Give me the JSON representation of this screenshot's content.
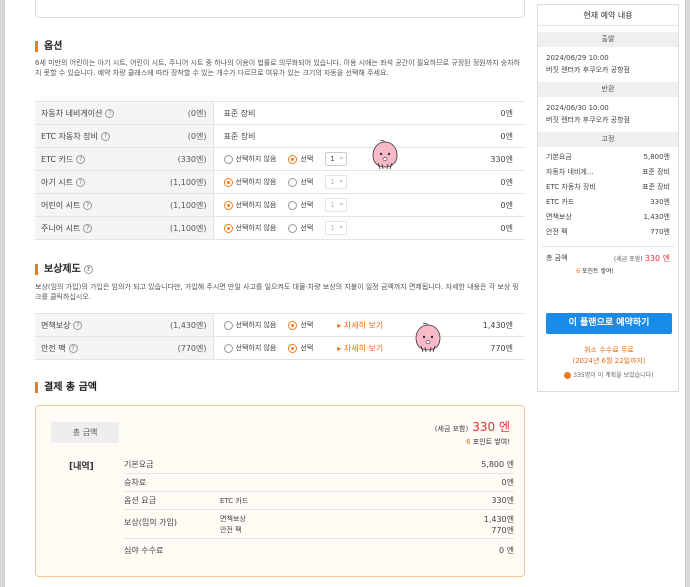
{
  "options": {
    "title": "옵션",
    "desc": "6세 미만의 어린이는 아기 시트, 어린이 시트, 주니어 시트 중 하나의 이용이 법률로 의무화되어 있습니다. 이용 시에는 좌석 공간이 필요하므로 규정된 정원까지 승차하지 못할 수 있습니다. 예약 차량 클래스에 따라 장착할 수 있는 개수가 다르므로 여유가 있는 크기의 자동을 선택해 주세요.",
    "rows": [
      {
        "name": "자동차 네비게이션",
        "price": "(0엔)",
        "text": "표준 장비",
        "value": "0엔"
      },
      {
        "name": "ETC 자동차 장비",
        "price": "(0엔)",
        "text": "표준 장비",
        "value": "0엔"
      },
      {
        "name": "ETC 카드",
        "price": "(330엔)",
        "opt_no": "선택하지 않음",
        "opt_yes": "선택",
        "qty": "1",
        "value": "330엔",
        "selected": "yes"
      },
      {
        "name": "아기 시트",
        "price": "(1,100엔)",
        "opt_no": "선택하지 않음",
        "opt_yes": "선택",
        "qty": "1",
        "value": "0엔",
        "selected": "no"
      },
      {
        "name": "어린이 시트",
        "price": "(1,100엔)",
        "opt_no": "선택하지 않음",
        "opt_yes": "선택",
        "qty": "1",
        "value": "0엔",
        "selected": "no"
      },
      {
        "name": "주니어 시트",
        "price": "(1,100엔)",
        "opt_no": "선택하지 않음",
        "opt_yes": "선택",
        "qty": "1",
        "value": "0엔",
        "selected": "no"
      }
    ]
  },
  "compensation": {
    "title": "보상제도",
    "desc": "보상(임의 가입)의 가입은 임의가 되고 있습니다만, 가입해 주시면 만일 사고를 일으켜도 대물·차량 보상의 지불이 일정 금액까지 면제됩니다. 자세한 내용은 각 보상 링크를 클릭하십시오.",
    "rows": [
      {
        "name": "면책보상",
        "price": "(1,430엔)",
        "opt_no": "선택하지 않음",
        "opt_yes": "선택",
        "link": "자세히 보기",
        "value": "1,430엔"
      },
      {
        "name": "안전 팩",
        "price": "(770엔)",
        "opt_no": "선택하지 않음",
        "opt_yes": "선택",
        "link": "자세히 보기",
        "value": "770엔"
      }
    ]
  },
  "total": {
    "title": "결제 총 금액",
    "label": "총 금액",
    "tax_note": "(세금 포함)",
    "amount": "330 엔",
    "points_num": "6",
    "points_text": "포인트 쌓여!",
    "detail_title": "[내역]",
    "details": [
      {
        "a": "기본요금",
        "b": "",
        "c": "5,800 엔"
      },
      {
        "a": "승차료",
        "b": "",
        "c": "0엔"
      },
      {
        "a": "옵션 요금",
        "b": "ETC 카드",
        "c": "330엔"
      },
      {
        "a": "보상(임의 가입)",
        "b": "면책보상",
        "c": "1,430엔",
        "b2": "안전 팩",
        "c2": "770엔"
      },
      {
        "a": "심야 수수료",
        "b": "",
        "c": "0 엔"
      }
    ]
  },
  "side": {
    "title": "현재 예약 내용",
    "depart_h": "출발",
    "depart_date": "2024/06/29 10:00",
    "depart_place": "버짓 렌터카 후쿠오카 공항점",
    "return_h": "반환",
    "return_date": "2024/06/30 10:00",
    "return_place": "버짓 렌터카 후쿠오카 공항점",
    "fixed_h": "고정",
    "items": [
      {
        "k": "기본요금",
        "v": "5,800엔"
      },
      {
        "k": "자동차 네비게...",
        "v": "표준 장비"
      },
      {
        "k": "ETC 자동차 장비",
        "v": "표준 장비"
      },
      {
        "k": "ETC 카드",
        "v": "330엔"
      },
      {
        "k": "면책보상",
        "v": "1,430엔"
      },
      {
        "k": "안전 팩",
        "v": "770엔"
      }
    ],
    "total_label": "총 금액",
    "tax_note": "(세금 포함)",
    "total_amount": "330 엔",
    "points_num": "6",
    "points_text": "포인트 쌓여!",
    "book_label": "이 플랜으로 예약하기",
    "cancel_1": "취소 수수료 무료",
    "cancel_2": "(2024년 6월 22일까지)",
    "people": "335명이 이 계획을 보았습니다!"
  }
}
